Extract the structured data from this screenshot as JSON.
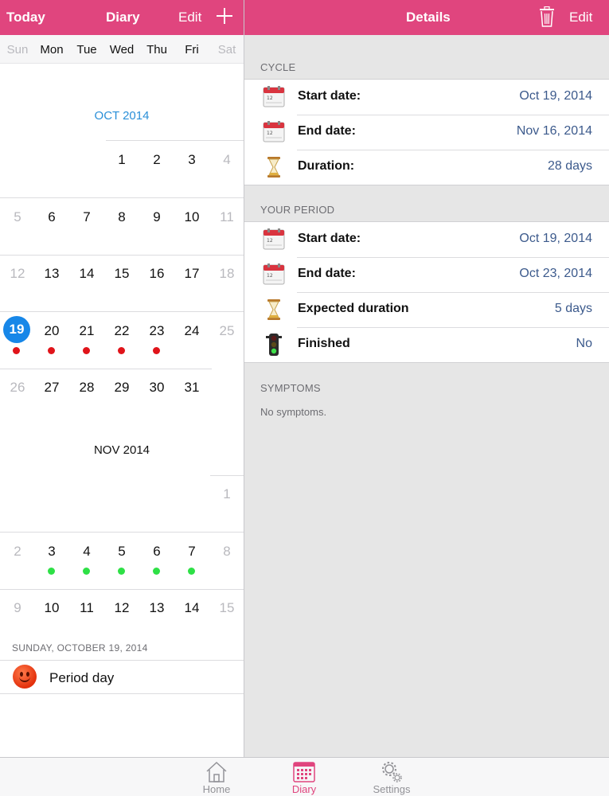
{
  "left_nav": {
    "today": "Today",
    "title": "Diary",
    "edit": "Edit"
  },
  "right_nav": {
    "title": "Details",
    "edit": "Edit"
  },
  "weekdays": [
    "Sun",
    "Mon",
    "Tue",
    "Wed",
    "Thu",
    "Fri",
    "Sat"
  ],
  "calendar": {
    "oct_title": "OCT 2014",
    "nov_title": "NOV 2014",
    "selected_day": "19",
    "colors": {
      "period_dot": "#e0141a",
      "fertile_dot": "#2ee046",
      "today": "#1787e8"
    }
  },
  "day_section": {
    "header": "SUNDAY, OCTOBER 19, 2014",
    "entry": "Period day",
    "entry_icon": "smiley-icon"
  },
  "details": {
    "cycle": {
      "header": "CYCLE",
      "rows": [
        {
          "label": "Start date:",
          "value": "Oct 19, 2014",
          "icon": "calendar-icon"
        },
        {
          "label": "End date:",
          "value": "Nov 16, 2014",
          "icon": "calendar-icon"
        },
        {
          "label": "Duration:",
          "value": "28 days",
          "icon": "hourglass-icon"
        }
      ]
    },
    "period": {
      "header": "YOUR PERIOD",
      "rows": [
        {
          "label": "Start date:",
          "value": "Oct 19, 2014",
          "icon": "calendar-icon"
        },
        {
          "label": "End date:",
          "value": "Oct 23, 2014",
          "icon": "calendar-icon"
        },
        {
          "label": "Expected duration",
          "value": "5 days",
          "icon": "hourglass-icon"
        },
        {
          "label": "Finished",
          "value": "No",
          "icon": "traffic-light-icon"
        }
      ]
    },
    "symptoms": {
      "header": "SYMPTOMS",
      "text": "No symptoms."
    }
  },
  "tabs": [
    {
      "label": "Home",
      "icon": "home-icon",
      "active": false
    },
    {
      "label": "Diary",
      "icon": "calendar-grid-icon",
      "active": true
    },
    {
      "label": "Settings",
      "icon": "gears-icon",
      "active": false
    }
  ],
  "theme": {
    "accent": "#e0457e",
    "value_text": "#3c5a8c"
  }
}
